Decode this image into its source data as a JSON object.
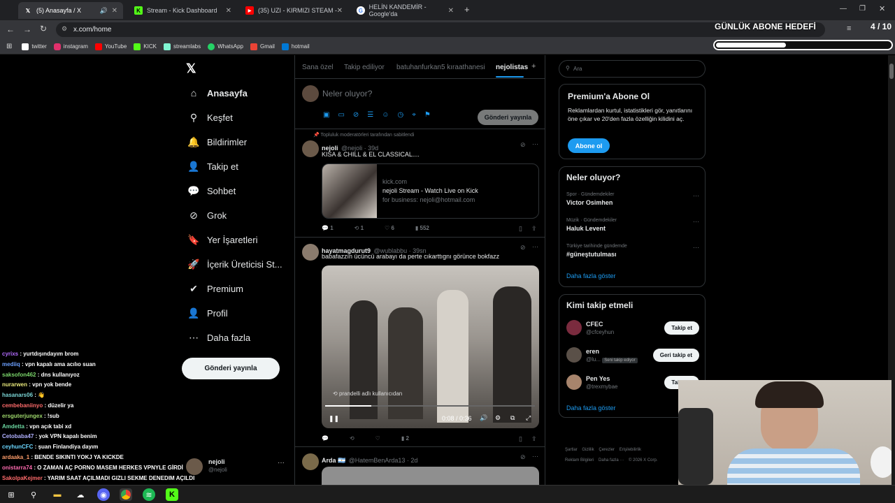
{
  "browser": {
    "tabs": [
      {
        "title": "(5) Anasayfa / X",
        "active": true,
        "icon": "x-logo-icon"
      },
      {
        "title": "Stream - Kick Dashboard",
        "active": false,
        "icon": "kick-icon"
      },
      {
        "title": "(35) UZI - KIRMIZI STEAM -",
        "active": false,
        "icon": "youtube-icon"
      },
      {
        "title": "HELİN KANDEMİR - Google'da",
        "active": false,
        "icon": "google-icon"
      }
    ],
    "new_tab": "+",
    "url": "x.com/home",
    "bookmarks": [
      {
        "label": "twitter",
        "icon": "x-logo-icon",
        "color": "#ffffff"
      },
      {
        "label": "instagram",
        "icon": "instagram-icon",
        "color": "#e1306c"
      },
      {
        "label": "YouTube",
        "icon": "youtube-icon",
        "color": "#ff0000"
      },
      {
        "label": "KICK",
        "icon": "kick-icon",
        "color": "#53fc18"
      },
      {
        "label": "streamlabs",
        "icon": "streamlabs-icon",
        "color": "#80f5d2"
      },
      {
        "label": "WhatsApp",
        "icon": "whatsapp-icon",
        "color": "#25d366"
      },
      {
        "label": "Gmail",
        "icon": "gmail-icon",
        "color": "#ea4335"
      },
      {
        "label": "hotmail",
        "icon": "hotmail-icon",
        "color": "#0078d4"
      }
    ]
  },
  "overlay": {
    "title": "GÜNLÜK ABONE HEDEFİ",
    "count": "4 / 10",
    "progress": 0.4
  },
  "sidebar": {
    "items": [
      {
        "label": "Anasayfa",
        "icon": "home-icon",
        "bold": true
      },
      {
        "label": "Keşfet",
        "icon": "search-icon"
      },
      {
        "label": "Bildirimler",
        "icon": "bell-icon"
      },
      {
        "label": "Takip et",
        "icon": "follow-icon"
      },
      {
        "label": "Sohbet",
        "icon": "chat-icon"
      },
      {
        "label": "Grok",
        "icon": "grok-icon"
      },
      {
        "label": "Yer İşaretleri",
        "icon": "bookmark-icon"
      },
      {
        "label": "İçerik Üreticisi St...",
        "icon": "rocket-icon"
      },
      {
        "label": "Premium",
        "icon": "verified-icon"
      },
      {
        "label": "Profil",
        "icon": "profile-icon"
      },
      {
        "label": "Daha fazla",
        "icon": "more-circle-icon"
      }
    ],
    "post_button": "Gönderi yayınla",
    "account_name": "nejoli",
    "account_handle": "@nejoli"
  },
  "feed": {
    "tabs": [
      "Sana özel",
      "Takip ediliyor",
      "batuhanfurkan5 kıraathanesi",
      "nejolistas"
    ],
    "add_tab": "+",
    "composer_placeholder": "Neler oluyor?",
    "composer_button": "Gönderi yayınla",
    "posts": [
      {
        "pinned_note": "Topluluk moderatörleri tarafından sabitlendi",
        "author": "nejoli",
        "handle": "@nejoli · 39d",
        "text": "KISA & CHILL & EL CLASSICAL....",
        "card_domain": "kick.com",
        "card_title": "nejoli Stream - Watch Live on Kick",
        "card_desc": "for business: nejoli@hotmail.com",
        "replies": "1",
        "reposts": "1",
        "likes": "6",
        "views": "552"
      },
      {
        "author": "hayatmagdurut9",
        "handle": "@wublabbu · 39sn",
        "text": "babafazzın ücüncü arabayı da perte cıkarttıgnı görünce bokfazz",
        "video_user": "prandelli adlı kullanıcıdan",
        "video_time": "0:08 / 0:36",
        "views": "2",
        "video_progress": 0.22
      },
      {
        "author": "Arda 🇦🇷",
        "handle": "@HatemBenArda13 · 2d"
      }
    ]
  },
  "right": {
    "search_placeholder": "Ara",
    "premium_title": "Premium'a Abone Ol",
    "premium_text": "Reklamlardan kurtul, istatistikleri gör, yanıtlarını öne çıkar ve 20'den fazla özelliğin kilidini aç.",
    "premium_button": "Abone ol",
    "trends_title": "Neler oluyor?",
    "trends": [
      {
        "category": "Spor · Gündemdekiler",
        "topic": "Victor Osimhen"
      },
      {
        "category": "Müzik · Gündemdekiler",
        "topic": "Haluk Levent"
      },
      {
        "category": "Türkiye tarihinde gündemde",
        "topic": "#güneştutulması"
      }
    ],
    "trends_more": "Daha fazla göster",
    "who_title": "Kimi takip etmeli",
    "who": [
      {
        "name": "CFEC",
        "handle": "@cfceyhun",
        "button": "Takip et"
      },
      {
        "name": "eren",
        "handle": "@lu...",
        "badge": "Seni takip ediyor",
        "button": "Geri takip et"
      },
      {
        "name": "Pen Yes",
        "handle": "@trexmybae",
        "button": "Takip et"
      }
    ],
    "who_more": "Daha fazla göster",
    "footer": [
      "Şartlar",
      "Gizlilik",
      "Çerezler",
      "Erişilebilirlik",
      "Reklam Bilgileri",
      "Daha fazla ···",
      "© 2026 X Corp."
    ]
  },
  "chat": [
    {
      "user": "cyrixs",
      "msg": "yurtdışındayım brom",
      "color": "#b36cff"
    },
    {
      "user": "mediiq",
      "msg": "vpn kapalı ama acılıo suan",
      "color": "#6ca0ff"
    },
    {
      "user": "saksofon462",
      "msg": "dns kullanıyoz",
      "color": "#7bd66b"
    },
    {
      "user": "nurarwen",
      "msg": "vpn yok bende",
      "color": "#e6e67a"
    },
    {
      "user": "hasanars06",
      "msg": "👋",
      "color": "#7bd6d6"
    },
    {
      "user": "cembebaniinyo",
      "msg": "düzelir ya",
      "color": "#ff6b6b"
    },
    {
      "user": "ersguterjungex",
      "msg": "!sub",
      "color": "#9dd66b"
    },
    {
      "user": "Amdetta",
      "msg": "vpn açık tabi xd",
      "color": "#6bd6a0"
    },
    {
      "user": "Cetobaba47",
      "msg": "yok VPN kapalı benim",
      "color": "#b0b0ff"
    },
    {
      "user": "ceyhunCFC",
      "msg": "şuan Finlandiya dayım",
      "color": "#6bd6ff"
    },
    {
      "user": "ardaaka_1",
      "msg": "BENDE SIKINTI YOKJ YA KICKDE",
      "color": "#ff9e6b"
    },
    {
      "user": "onistarra74",
      "msg": "O ZAMAN AÇ PORNO MASEM HERKES VPNYLE GİRDİ",
      "color": "#ff6bb0"
    },
    {
      "user": "SakolpaKejmer",
      "msg": "YARIM SAAT AÇILMADI GIZLI SEKME DENEDIM AÇILDI",
      "color": "#ff6b6b"
    }
  ],
  "taskbar": [
    "windows-icon",
    "search-icon",
    "folder-icon",
    "cloud-icon",
    "discord-icon",
    "chrome-icon",
    "spotify-icon",
    "kick-icon"
  ]
}
